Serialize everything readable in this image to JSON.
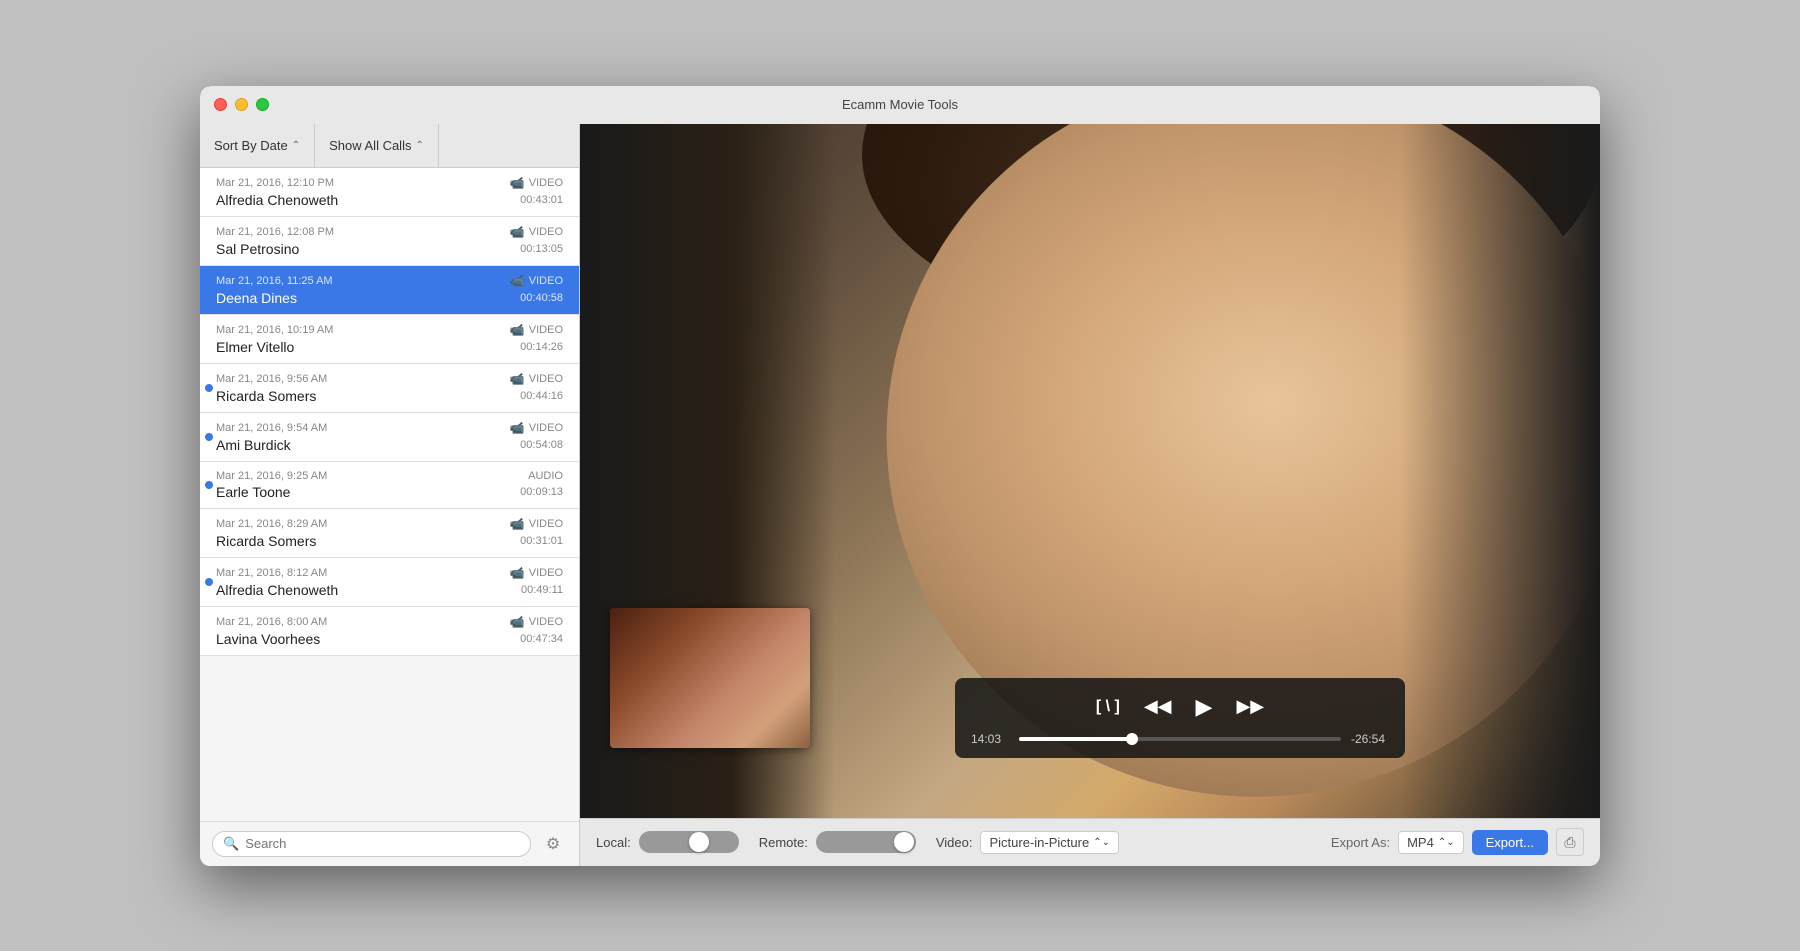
{
  "window": {
    "title": "Ecamm Movie Tools",
    "controls": {
      "close": "close",
      "minimize": "minimize",
      "maximize": "maximize"
    }
  },
  "sidebar": {
    "sort_btn": "Sort By Date",
    "show_btn": "Show All Calls",
    "calls": [
      {
        "id": 1,
        "date": "Mar 21, 2016, 12:10 PM",
        "name": "Alfredia Chenoweth",
        "type": "VIDEO",
        "duration": "00:43:01",
        "unread": false,
        "selected": false
      },
      {
        "id": 2,
        "date": "Mar 21, 2016, 12:08 PM",
        "name": "Sal Petrosino",
        "type": "VIDEO",
        "duration": "00:13:05",
        "unread": false,
        "selected": false
      },
      {
        "id": 3,
        "date": "Mar 21, 2016, 11:25 AM",
        "name": "Deena Dines",
        "type": "VIDEO",
        "duration": "00:40:58",
        "unread": false,
        "selected": true
      },
      {
        "id": 4,
        "date": "Mar 21, 2016, 10:19 AM",
        "name": "Elmer Vitello",
        "type": "VIDEO",
        "duration": "00:14:26",
        "unread": false,
        "selected": false
      },
      {
        "id": 5,
        "date": "Mar 21, 2016, 9:56 AM",
        "name": "Ricarda Somers",
        "type": "VIDEO",
        "duration": "00:44:16",
        "unread": true,
        "selected": false
      },
      {
        "id": 6,
        "date": "Mar 21, 2016, 9:54 AM",
        "name": "Ami Burdick",
        "type": "VIDEO",
        "duration": "00:54:08",
        "unread": true,
        "selected": false
      },
      {
        "id": 7,
        "date": "Mar 21, 2016, 9:25 AM",
        "name": "Earle Toone",
        "type": "AUDIO",
        "duration": "00:09:13",
        "unread": true,
        "selected": false
      },
      {
        "id": 8,
        "date": "Mar 21, 2016, 8:29 AM",
        "name": "Ricarda Somers",
        "type": "VIDEO",
        "duration": "00:31:01",
        "unread": false,
        "selected": false
      },
      {
        "id": 9,
        "date": "Mar 21, 2016, 8:12 AM",
        "name": "Alfredia Chenoweth",
        "type": "VIDEO",
        "duration": "00:49:11",
        "unread": true,
        "selected": false
      },
      {
        "id": 10,
        "date": "Mar 21, 2016, 8:00 AM",
        "name": "Lavina Voorhees",
        "type": "VIDEO",
        "duration": "00:47:34",
        "unread": false,
        "selected": false
      }
    ],
    "search": {
      "placeholder": "Search"
    }
  },
  "player": {
    "current_time": "14:03",
    "remaining_time": "-26:54",
    "progress_pct": 35
  },
  "bottom_bar": {
    "local_label": "Local:",
    "remote_label": "Remote:",
    "video_label": "Video:",
    "video_mode": "Picture-in-Picture",
    "export_as_label": "Export As:",
    "export_format": "MP4",
    "export_btn": "Export..."
  }
}
